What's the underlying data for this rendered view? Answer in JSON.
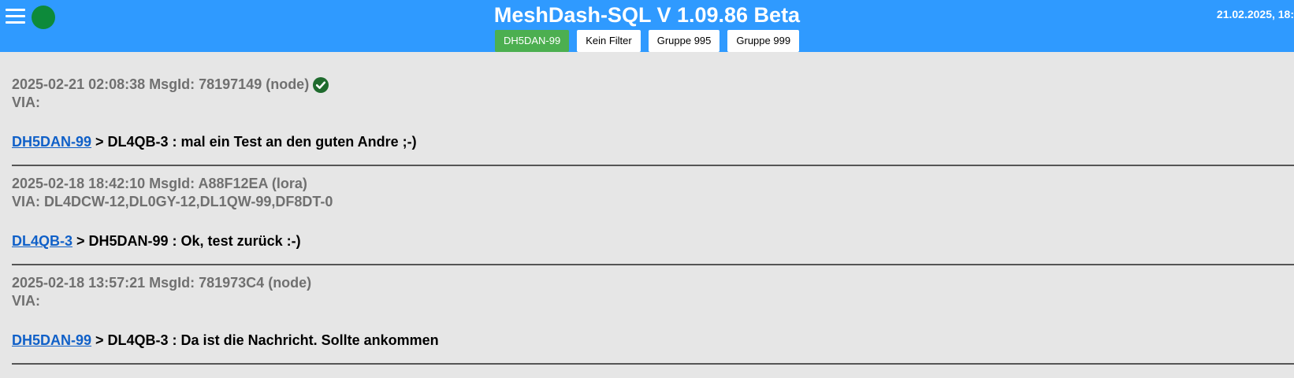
{
  "header": {
    "title": "MeshDash-SQL V 1.09.86 Beta",
    "datetime": "21.02.2025, 18:",
    "menu_icon": "hamburger-menu-icon",
    "status_color": "#0d8a3a",
    "background": "#2f9aff"
  },
  "filters": [
    {
      "label": "DH5DAN-99",
      "active": true
    },
    {
      "label": "Kein Filter",
      "active": false
    },
    {
      "label": "Gruppe 995",
      "active": false
    },
    {
      "label": "Gruppe 999",
      "active": false
    }
  ],
  "messages": [
    {
      "meta": "2025-02-21 02:08:38 MsgId: 78197149 (node)",
      "via": "VIA:",
      "acknowledged": true,
      "sender": "DH5DAN-99",
      "text": " > DL4QB-3 : mal ein Test an den guten Andre ;-)"
    },
    {
      "meta": "2025-02-18 18:42:10 MsgId: A88F12EA (lora)",
      "via": "VIA: DL4DCW-12,DL0GY-12,DL1QW-99,DF8DT-0",
      "acknowledged": false,
      "sender": "DL4QB-3",
      "text": " > DH5DAN-99 : Ok, test zurück :-)"
    },
    {
      "meta": "2025-02-18 13:57:21 MsgId: 781973C4 (node)",
      "via": "VIA:",
      "acknowledged": false,
      "sender": "DH5DAN-99",
      "text": " > DL4QB-3 : Da ist die Nachricht. Sollte ankommen"
    }
  ]
}
